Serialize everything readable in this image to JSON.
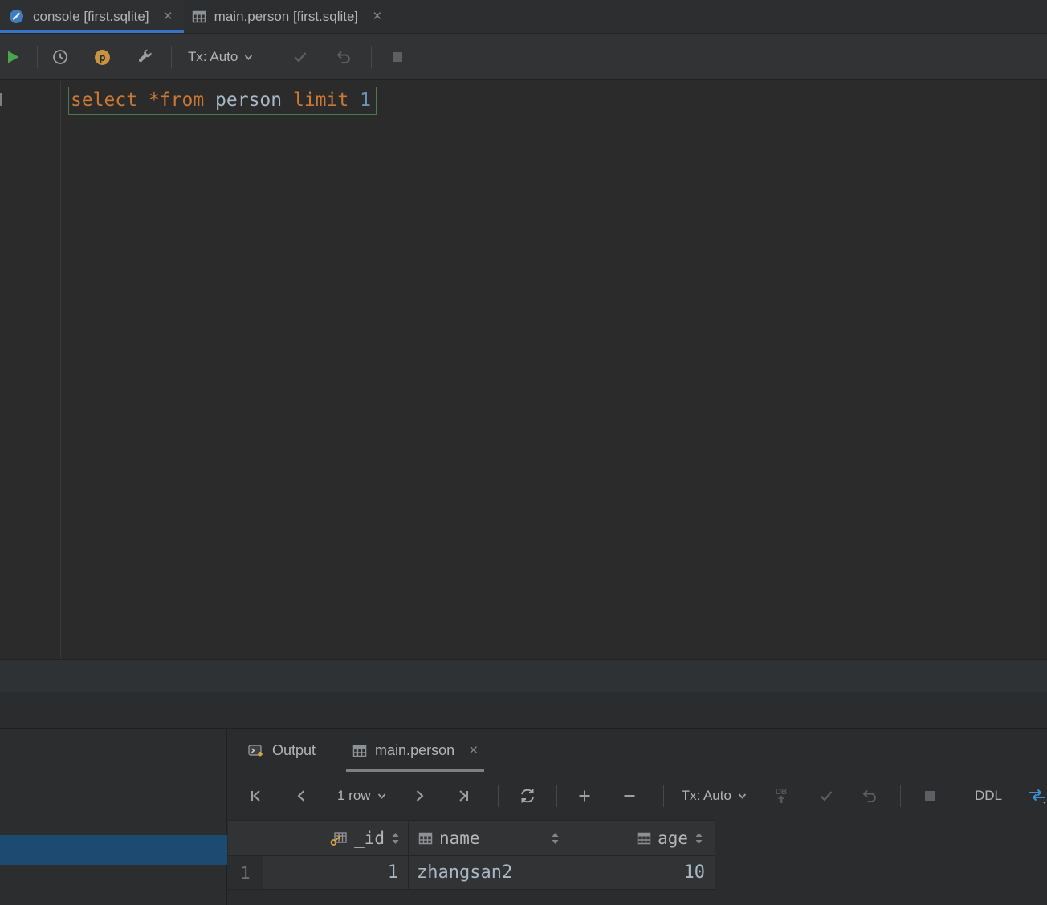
{
  "colors": {
    "accent_blue": "#3674c8",
    "selection_blue": "#1d4a70",
    "keyword_orange": "#cc7832",
    "identifier_gray": "#a9b7c6",
    "number_blue": "#6897bb",
    "key_gold": "#d8a442",
    "run_green": "#4aa54f",
    "statement_outline_green": "#4b7a4f"
  },
  "editor_tabs": [
    {
      "label": "console [first.sqlite]",
      "icon": "console-file-icon",
      "active": true
    },
    {
      "label": "main.person [first.sqlite]",
      "icon": "table-icon",
      "active": false
    }
  ],
  "console_toolbar": {
    "tx_label": "Tx: Auto",
    "icons": [
      "run-icon",
      "history-clock-icon",
      "p-badge-icon",
      "wrench-icon",
      "chevron-down-icon",
      "commit-check-icon",
      "rollback-undo-icon",
      "stop-icon"
    ]
  },
  "editor": {
    "sql_plain": "select *from person limit 1",
    "sql_tokens": [
      {
        "t": "select ",
        "c": "#cc7832"
      },
      {
        "t": "*",
        "c": "#cc7832"
      },
      {
        "t": "from",
        "c": "#cc7832"
      },
      {
        "t": " person ",
        "c": "#a9b7c6"
      },
      {
        "t": "limit ",
        "c": "#cc7832"
      },
      {
        "t": "1",
        "c": "#6897bb"
      }
    ]
  },
  "results_panel": {
    "tabs": [
      {
        "label": "Output",
        "icon": "output-icon",
        "active": false
      },
      {
        "label": "main.person",
        "icon": "table-icon",
        "active": true
      }
    ],
    "toolbar": {
      "rows_label": "1 row",
      "tx_label": "Tx: Auto",
      "ddl_label": "DDL",
      "icons": [
        "first-page-icon",
        "previous-page-icon",
        "chevron-down-icon",
        "next-page-icon",
        "last-page-icon",
        "refresh-icon",
        "add-row-icon",
        "delete-row-icon",
        "submit-db-icon",
        "commit-check-icon",
        "rollback-undo-icon",
        "stop-icon",
        "compare-arrows-icon"
      ]
    },
    "table": {
      "columns": [
        {
          "name": "_id",
          "icon": "key-column-icon",
          "sortable": true
        },
        {
          "name": "name",
          "icon": "column-icon",
          "sortable": true
        },
        {
          "name": "age",
          "icon": "column-icon",
          "sortable": true
        }
      ],
      "rows": [
        {
          "num": "1",
          "values": [
            "1",
            "zhangsan2",
            "10"
          ]
        }
      ]
    }
  }
}
